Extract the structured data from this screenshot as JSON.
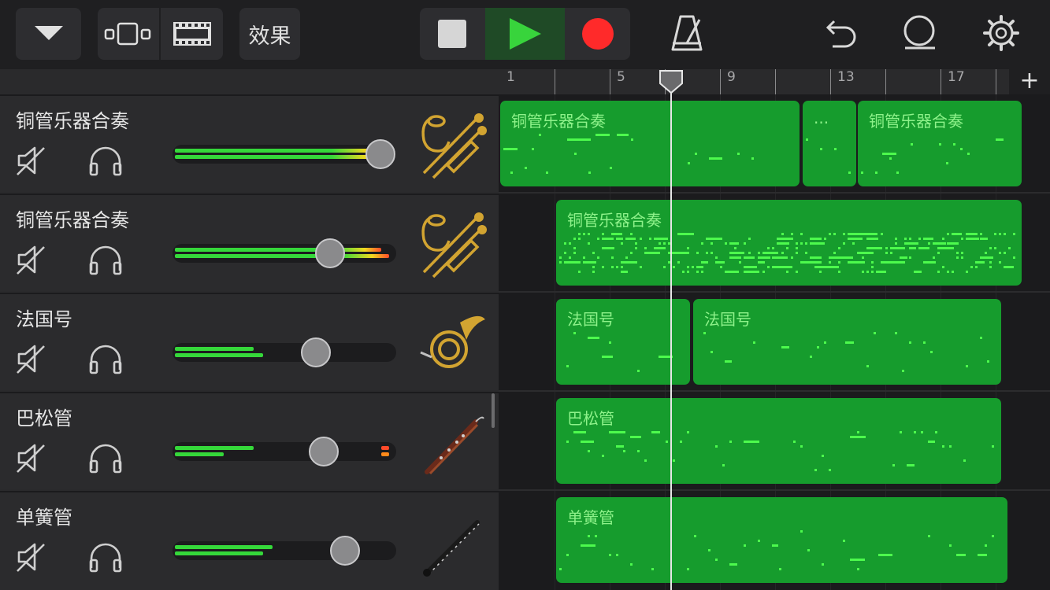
{
  "toolbar": {
    "effects_label": "效果"
  },
  "timeline": {
    "ruler_labels": [
      "1",
      "5",
      "9",
      "13",
      "17"
    ],
    "add_section_label": "+"
  },
  "tracks": [
    {
      "name": "铜管乐器合奏",
      "instrument": "brass-ensemble-icon",
      "volume": 0.93,
      "meter_top": 1.0,
      "meter_bottom": 1.0,
      "regions": [
        "铜管乐器合奏",
        "...",
        "铜管乐器合奏"
      ]
    },
    {
      "name": "铜管乐器合奏",
      "instrument": "brass-ensemble-icon",
      "volume": 0.7,
      "meter_top": 0.95,
      "meter_bottom": 0.98,
      "regions": [
        "铜管乐器合奏"
      ]
    },
    {
      "name": "法国号",
      "instrument": "french-horn-icon",
      "volume": 0.64,
      "meter_top": 0.4,
      "meter_bottom": 0.45,
      "regions": [
        "法国号",
        "法国号"
      ]
    },
    {
      "name": "巴松管",
      "instrument": "bassoon-icon",
      "volume": 0.68,
      "meter_top": 0.4,
      "meter_bottom": 0.3,
      "regions": [
        "巴松管"
      ]
    },
    {
      "name": "单簧管",
      "instrument": "clarinet-icon",
      "volume": 0.77,
      "meter_top": 0.45,
      "meter_bottom": 0.42,
      "regions": [
        "单簧管"
      ]
    }
  ],
  "colors": {
    "region": "#169c2d",
    "region_text": "#8ef28a",
    "note": "#4dfa4d",
    "play": "#38d43c",
    "record": "#ff2a2a",
    "meter": "#35d83a"
  }
}
